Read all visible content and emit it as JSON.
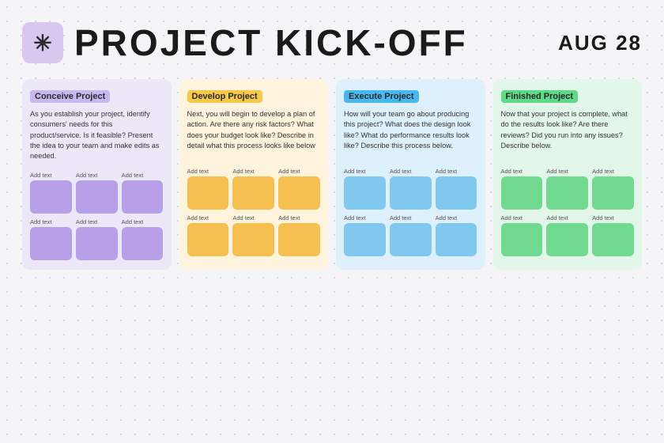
{
  "header": {
    "title": "PROJECT KICK-OFF",
    "date": "AUG 28",
    "star_symbol": "✳"
  },
  "columns": [
    {
      "id": "conceive",
      "label": "Conceive Project",
      "class": "col-conceive",
      "description": "As you establish your project, identify consumers' needs for this product/service. Is it feasible? Present the idea to your team and make edits as needed.",
      "rows": [
        [
          "Add text",
          "Add text",
          "Add text"
        ],
        [
          "Add text",
          "Add text",
          "Add text"
        ]
      ]
    },
    {
      "id": "develop",
      "label": "Develop Project",
      "class": "col-develop",
      "description": "Next, you will begin to develop a plan of action. Are there any risk factors? What does your budget look like? Describe in detail what this process looks like below",
      "rows": [
        [
          "Add text",
          "Add text",
          "Add text"
        ],
        [
          "Add text",
          "Add text",
          "Add text"
        ]
      ]
    },
    {
      "id": "execute",
      "label": "Execute Project",
      "class": "col-execute",
      "description": "How will your team go about producing this project? What does the design look like? What do performance results look like? Describe this process below.",
      "rows": [
        [
          "Add text",
          "Add text",
          "Add text"
        ],
        [
          "Add text",
          "Add text",
          "Add text"
        ]
      ]
    },
    {
      "id": "finished",
      "label": "Finished Project",
      "class": "col-finished",
      "description": "Now that your project is complete, what do the results look like? Are there reviews? Did you run into any issues? Describe below.",
      "rows": [
        [
          "Add text",
          "Add text",
          "Add text"
        ],
        [
          "Add text",
          "Add text",
          "Add text"
        ]
      ]
    }
  ]
}
